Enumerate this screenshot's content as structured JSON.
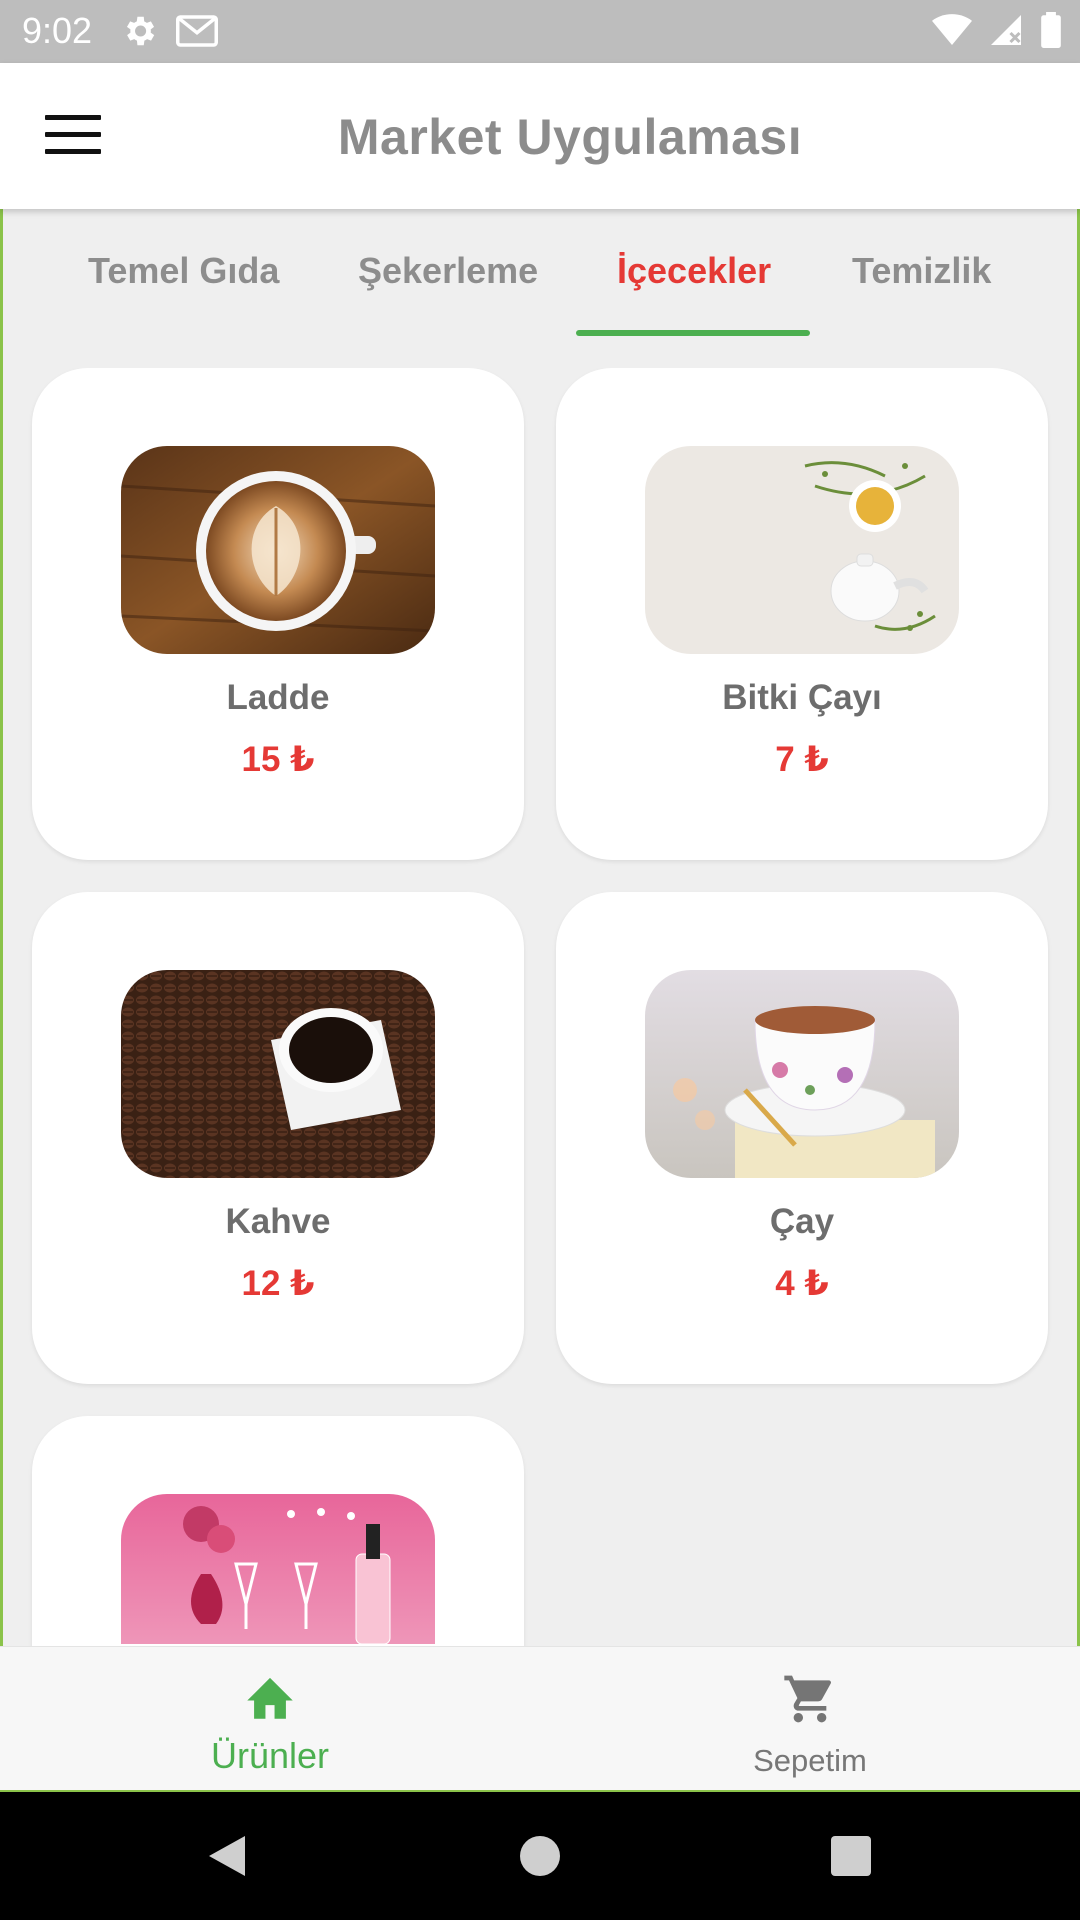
{
  "status_bar": {
    "time": "9:02"
  },
  "app_bar": {
    "title": "Market Uygulaması"
  },
  "tabs": [
    {
      "label": "Temel Gıda",
      "active": false
    },
    {
      "label": "Şekerleme",
      "active": false
    },
    {
      "label": "İçecekler",
      "active": true
    },
    {
      "label": "Temizlik",
      "active": false
    }
  ],
  "products": [
    {
      "name": "Ladde",
      "price": "15 ₺",
      "image": "latte-cup"
    },
    {
      "name": "Bitki Çayı",
      "price": "7 ₺",
      "image": "herbal-tea-pot"
    },
    {
      "name": "Kahve",
      "price": "12 ₺",
      "image": "coffee-beans-cup"
    },
    {
      "name": "Çay",
      "price": "4 ₺",
      "image": "floral-tea-cup"
    },
    {
      "name": "",
      "price": "",
      "image": "pink-wine-glasses"
    }
  ],
  "bottom_nav": {
    "products_label": "Ürünler",
    "cart_label": "Sepetim"
  },
  "colors": {
    "accent_green": "#4caf50",
    "price_red": "#e53935",
    "frame_green": "#8bc34a"
  }
}
